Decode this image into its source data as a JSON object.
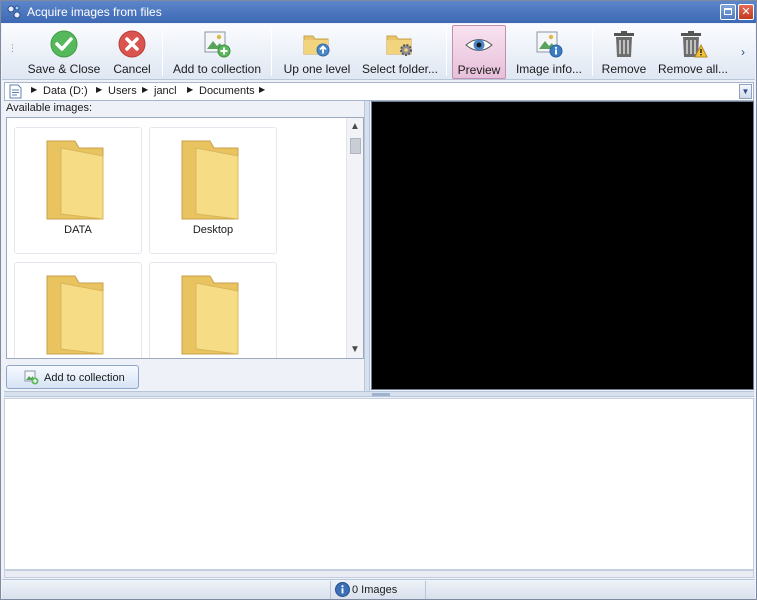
{
  "window": {
    "title": "Acquire images from files"
  },
  "toolbar": {
    "save_close": "Save & Close",
    "cancel": "Cancel",
    "add_to_collection": "Add to collection",
    "up_one_level": "Up one level",
    "select_folder": "Select folder...",
    "preview": "Preview",
    "image_info": "Image info...",
    "remove": "Remove",
    "remove_all": "Remove all..."
  },
  "address": {
    "crumbs": [
      "Data (D:)",
      "Users",
      "jancl",
      "Documents"
    ]
  },
  "browser": {
    "label": "Available images:",
    "tiles": [
      "DATA",
      "Desktop",
      "",
      ""
    ],
    "add_button": "Add to collection"
  },
  "status": {
    "count": "0 Images"
  },
  "colors": {
    "preview_bg": "#000000",
    "save_green": "#55b85a",
    "cancel_red": "#d9534f",
    "folder_yellow": "#f5d77c",
    "accent_blue": "#3d68b4"
  }
}
